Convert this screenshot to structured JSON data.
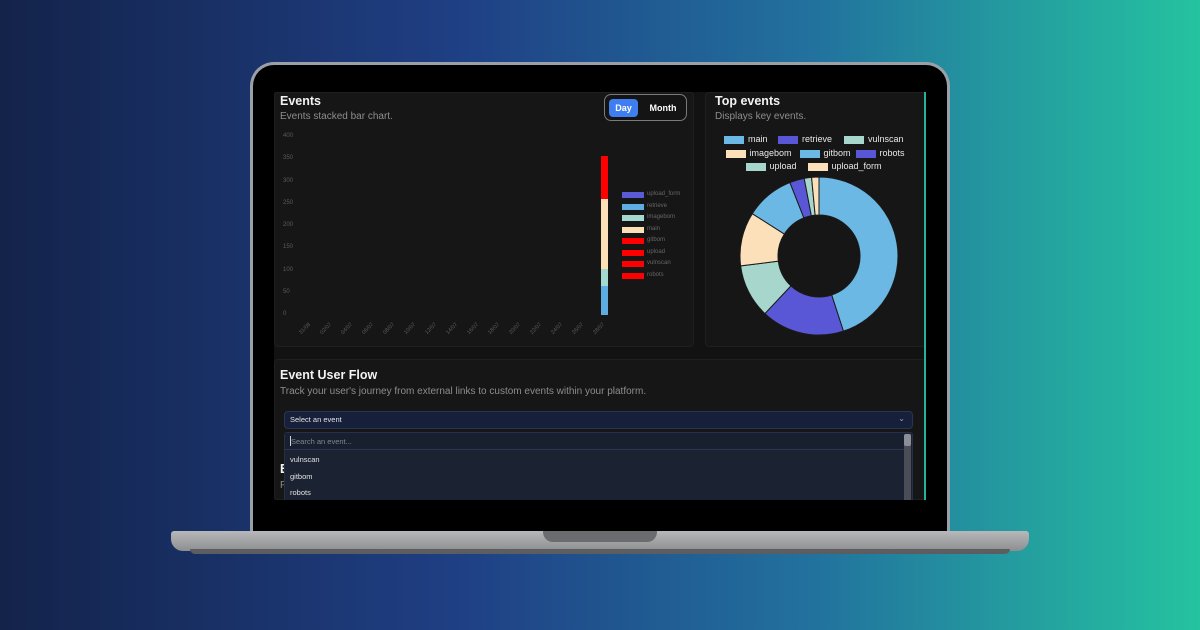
{
  "events_card": {
    "title": "Events",
    "subtitle": "Events stacked bar chart.",
    "toggle": {
      "day": "Day",
      "month": "Month",
      "active": "Day"
    }
  },
  "chart_data": [
    {
      "type": "bar",
      "stacked": true,
      "title": "Events",
      "ylim": [
        0,
        400
      ],
      "yticks": [
        "0",
        "50",
        "100",
        "150",
        "200",
        "250",
        "300",
        "350",
        "400"
      ],
      "categories": [
        "31/08",
        "02/07",
        "04/07",
        "06/07",
        "08/07",
        "10/07",
        "12/07",
        "14/07",
        "16/07",
        "18/07",
        "20/07",
        "22/07",
        "24/07",
        "26/07",
        "28/07"
      ],
      "series": [
        {
          "name": "upload_form",
          "color": "#5b5bd6",
          "values": [
            0,
            0,
            0,
            0,
            0,
            0,
            0,
            0,
            0,
            0,
            0,
            0,
            0,
            0,
            0
          ]
        },
        {
          "name": "retrieve",
          "color": "#5dade2",
          "values": [
            0,
            0,
            0,
            0,
            0,
            0,
            0,
            0,
            0,
            0,
            0,
            0,
            0,
            0,
            65
          ]
        },
        {
          "name": "imagebom",
          "color": "#a3d9d0",
          "values": [
            0,
            0,
            0,
            0,
            0,
            0,
            0,
            0,
            0,
            0,
            0,
            0,
            0,
            0,
            38
          ]
        },
        {
          "name": "main",
          "color": "#fbe0b8",
          "values": [
            0,
            0,
            0,
            0,
            0,
            0,
            0,
            0,
            0,
            0,
            0,
            0,
            0,
            0,
            157
          ]
        },
        {
          "name": "gitbom",
          "color": "#ff0000",
          "values": [
            0,
            0,
            0,
            0,
            0,
            0,
            0,
            0,
            0,
            0,
            0,
            0,
            0,
            0,
            0
          ]
        },
        {
          "name": "upload",
          "color": "#ff0000",
          "values": [
            0,
            0,
            0,
            0,
            0,
            0,
            0,
            0,
            0,
            0,
            0,
            0,
            0,
            0,
            0
          ]
        },
        {
          "name": "vulnscan",
          "color": "#ff0000",
          "values": [
            0,
            0,
            0,
            0,
            0,
            0,
            0,
            0,
            0,
            0,
            0,
            0,
            0,
            0,
            0
          ]
        },
        {
          "name": "robots",
          "color": "#ff0000",
          "values": [
            0,
            0,
            0,
            0,
            0,
            0,
            0,
            0,
            0,
            0,
            0,
            0,
            0,
            0,
            97
          ]
        }
      ],
      "legend_position": "right"
    },
    {
      "type": "pie",
      "donut": true,
      "title": "Top events",
      "legend_position": "top",
      "labels": [
        "main",
        "retrieve",
        "vulnscan",
        "imagebom",
        "gitbom",
        "robots",
        "upload",
        "upload_form"
      ],
      "colors": [
        "#6cb8e4",
        "#5a57d6",
        "#a6d6cc",
        "#fbe0ba",
        "#6cb8e4",
        "#5a57d6",
        "#a6d6cc",
        "#fbe0ba"
      ],
      "values": [
        45,
        17,
        11,
        11,
        10,
        3,
        1.5,
        1.5
      ]
    }
  ],
  "top_events_card": {
    "title": "Top events",
    "subtitle": "Displays key events."
  },
  "flow_card": {
    "title": "Event User Flow",
    "subtitle": "Track your user's journey from external links to custom events within your platform.",
    "select_value": "Select an event",
    "search_placeholder": "Search an event...",
    "options": [
      "vulnscan",
      "gitbom",
      "robots"
    ],
    "hidden_title_initial": "E",
    "hidden_sub_initial": "F"
  }
}
